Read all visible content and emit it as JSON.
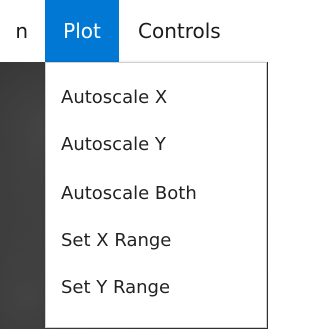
{
  "menubar": {
    "items": [
      {
        "label": "n"
      },
      {
        "label": "Plot",
        "active": true
      },
      {
        "label": "Controls"
      }
    ],
    "active_color": "#0078d4"
  },
  "plot_menu": {
    "items": [
      {
        "label": "Autoscale X"
      },
      {
        "label": "Autoscale Y"
      },
      {
        "label": "Autoscale Both"
      },
      {
        "label": "Set X Range"
      },
      {
        "label": "Set Y Range"
      }
    ]
  }
}
